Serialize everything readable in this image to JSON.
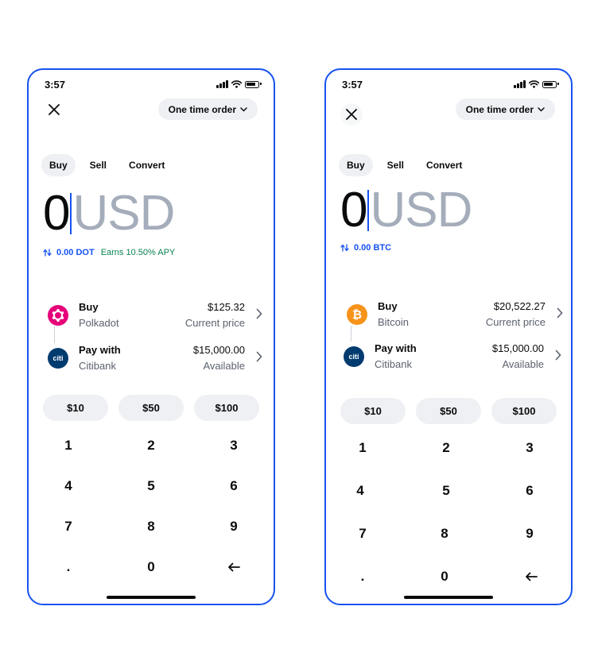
{
  "screens": [
    {
      "status_time": "3:57",
      "order_type": "One time order",
      "tabs": [
        "Buy",
        "Sell",
        "Convert"
      ],
      "amount": {
        "value": "0",
        "currency": "USD"
      },
      "conversion": {
        "value": "0.00 DOT",
        "apy": "Earns 10.50% APY"
      },
      "buy_asset": {
        "label": "Buy",
        "name": "Polkadot",
        "price": "$125.32",
        "price_note": "Current price",
        "icon": "polkadot-icon",
        "icon_color": "#e6007a"
      },
      "pay_with": {
        "label": "Pay with",
        "name": "Citibank",
        "balance": "$15,000.00",
        "balance_note": "Available",
        "icon": "citibank-icon",
        "icon_text": "citi",
        "icon_color": "#003b70"
      },
      "presets": [
        "$10",
        "$50",
        "$100"
      ],
      "keys": [
        "1",
        "2",
        "3",
        "4",
        "5",
        "6",
        "7",
        "8",
        "9",
        ".",
        "0"
      ]
    },
    {
      "status_time": "3:57",
      "order_type": "One time order",
      "tabs": [
        "Buy",
        "Sell",
        "Convert"
      ],
      "amount": {
        "value": "0",
        "currency": "USD"
      },
      "conversion": {
        "value": "0.00 BTC"
      },
      "buy_asset": {
        "label": "Buy",
        "name": "Bitcoin",
        "price": "$20,522.27",
        "price_note": "Current price",
        "icon": "bitcoin-icon",
        "icon_text": "₿",
        "icon_color": "#f7931a"
      },
      "pay_with": {
        "label": "Pay with",
        "name": "Citibank",
        "balance": "$15,000.00",
        "balance_note": "Available",
        "icon": "citibank-icon",
        "icon_text": "citi",
        "icon_color": "#003b70"
      },
      "presets": [
        "$10",
        "$50",
        "$100"
      ],
      "keys": [
        "1",
        "2",
        "3",
        "4",
        "5",
        "6",
        "7",
        "8",
        "9",
        ".",
        "0"
      ]
    }
  ],
  "accent_color": "#1652f0",
  "positive_color": "#098551"
}
